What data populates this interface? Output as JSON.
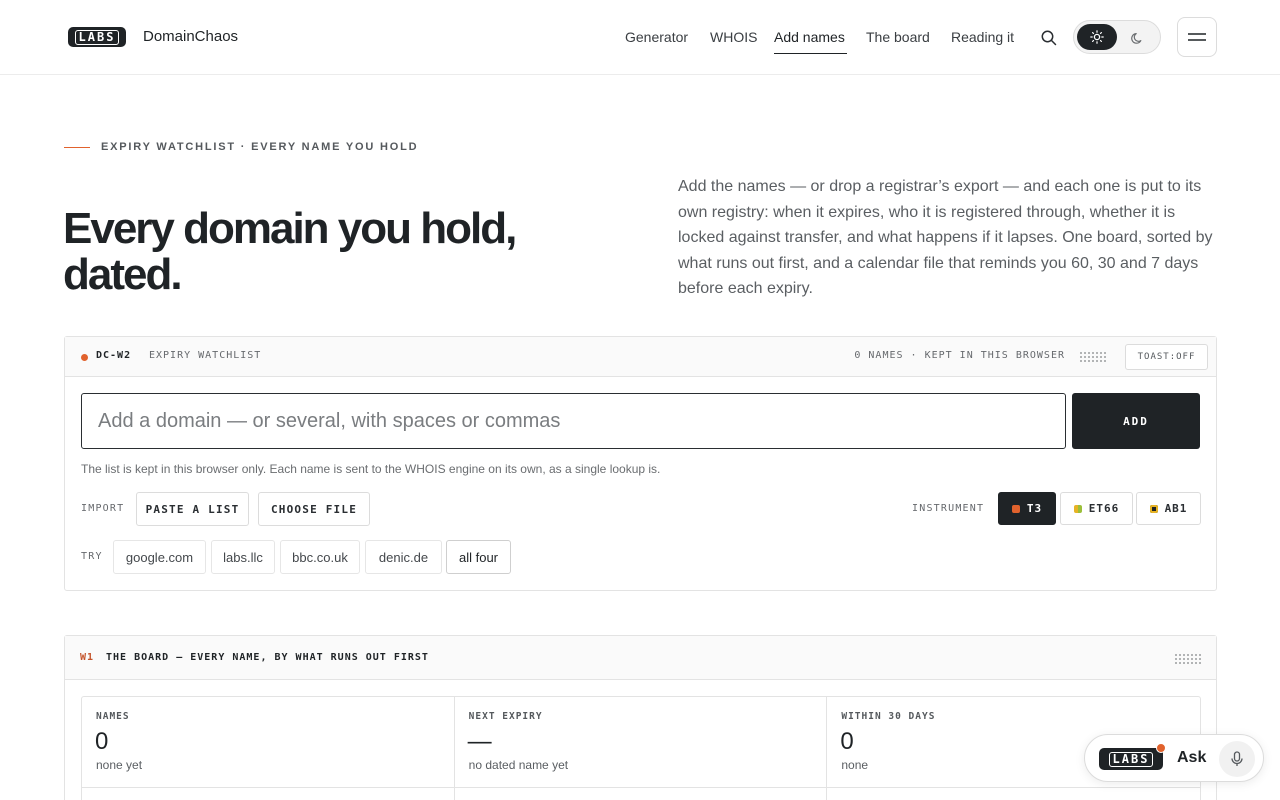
{
  "brand": {
    "logo_text": "LABS",
    "name": "DomainChaos"
  },
  "nav": [
    {
      "label": "Generator"
    },
    {
      "label": "WHOIS"
    },
    {
      "label": "Add names",
      "active": true
    },
    {
      "label": "The board"
    },
    {
      "label": "Reading it"
    }
  ],
  "hero": {
    "eyebrow": "EXPIRY WATCHLIST · EVERY NAME YOU HOLD",
    "title_line1": "Every domain you hold,",
    "title_line2": "dated.",
    "lead": "Add the names — or drop a registrar’s export — and each one is put to its own registry: when it expires, who it is registered through, whether it is locked against transfer, and what happens if it lapses. One board, sorted by what runs out first, and a calendar file that reminds you 60, 30 and 7 days before each expiry."
  },
  "watchlist": {
    "code": "DC-W2",
    "name": "EXPIRY WATCHLIST",
    "meta": "0 NAMES · KEPT IN THIS BROWSER",
    "toast": "TOAST:OFF",
    "input_placeholder": "Add a domain — or several, with spaces or commas",
    "input_value": "",
    "add_label": "ADD",
    "note": "The list is kept in this browser only. Each name is sent to the WHOIS engine on its own, as a single lookup is.",
    "import_label": "IMPORT",
    "paste_label": "PASTE A LIST",
    "file_label": "CHOOSE FILE",
    "instrument_label": "INSTRUMENT",
    "instruments": [
      {
        "label": "T3",
        "color": "#e1622d",
        "active": true
      },
      {
        "label": "ET66",
        "color": "#9bbf3a",
        "active": false
      },
      {
        "label": "AB1",
        "color": "#e6b325",
        "active": false
      }
    ],
    "try_label": "TRY",
    "examples": [
      "google.com",
      "labs.llc",
      "bbc.co.uk",
      "denic.de",
      "all four"
    ]
  },
  "board": {
    "code": "W1",
    "title": "THE BOARD — EVERY NAME, BY WHAT RUNS OUT FIRST",
    "stats": [
      {
        "label": "NAMES",
        "value": "0",
        "sub": "none yet"
      },
      {
        "label": "NEXT EXPIRY",
        "value": "—",
        "sub": "no dated name yet"
      },
      {
        "label": "WITHIN 30 DAYS",
        "value": "0",
        "sub": "none"
      }
    ]
  },
  "ask": {
    "logo_text": "LABS",
    "label": "Ask"
  },
  "colors": {
    "accent": "#e1622d",
    "ink": "#1f2326"
  }
}
